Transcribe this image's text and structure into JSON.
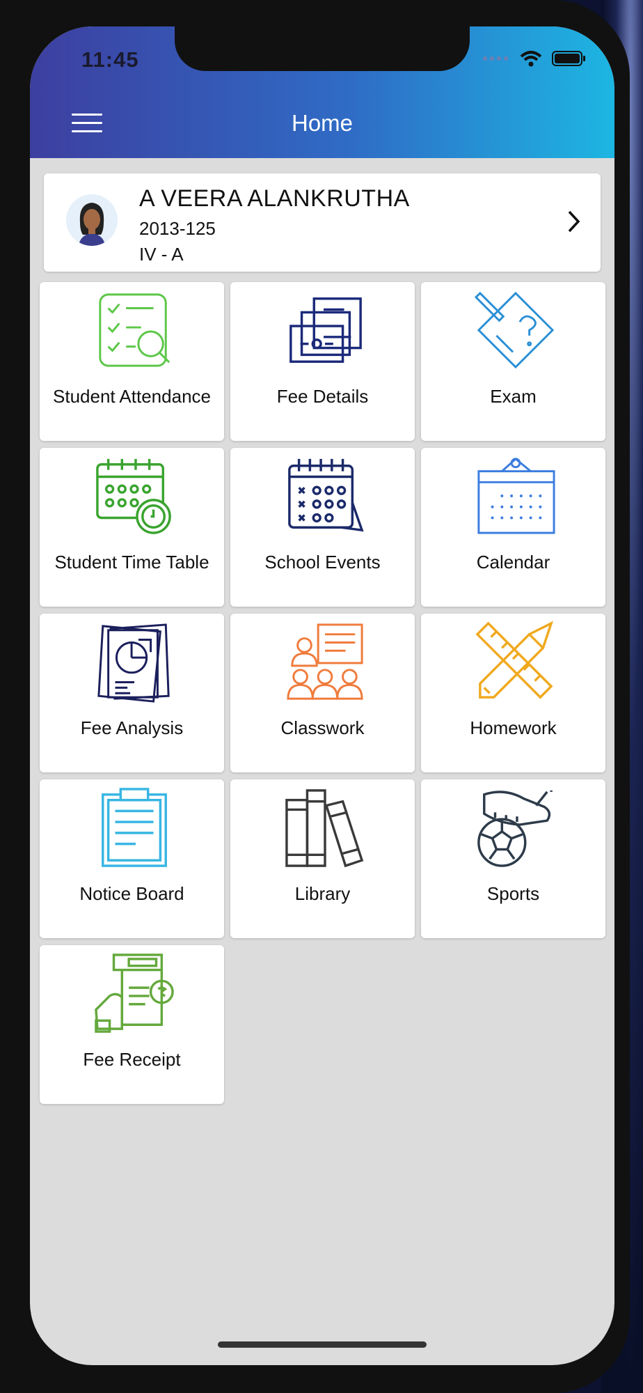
{
  "status_bar": {
    "time": "11:45"
  },
  "header": {
    "title": "Home"
  },
  "student": {
    "name": "A VEERA ALANKRUTHA",
    "id": "2013-125",
    "class": "IV - A"
  },
  "tiles": [
    {
      "label": "Student Attendance",
      "icon": "attendance-checklist-icon",
      "color": "#5cc748"
    },
    {
      "label": "Fee Details",
      "icon": "money-bills-icon",
      "color": "#1b2a7a"
    },
    {
      "label": "Exam",
      "icon": "exam-paper-icon",
      "color": "#2a8fd6"
    },
    {
      "label": "Student Time Table",
      "icon": "calendar-clock-icon",
      "color": "#3aa42f"
    },
    {
      "label": "School Events",
      "icon": "event-calendar-icon",
      "color": "#1b2a6a"
    },
    {
      "label": "Calendar",
      "icon": "wall-calendar-icon",
      "color": "#3c7de0"
    },
    {
      "label": "Fee Analysis",
      "icon": "pie-chart-report-icon",
      "color": "#1b1f5c"
    },
    {
      "label": "Classwork",
      "icon": "classroom-icon",
      "color": "#f07b3c"
    },
    {
      "label": "Homework",
      "icon": "pencil-ruler-icon",
      "color": "#f0a91e"
    },
    {
      "label": "Notice Board",
      "icon": "clipboard-icon",
      "color": "#37b6e3"
    },
    {
      "label": "Library",
      "icon": "books-icon",
      "color": "#3a3a3a"
    },
    {
      "label": "Sports",
      "icon": "football-boot-icon",
      "color": "#2d3b4a"
    },
    {
      "label": "Fee Receipt",
      "icon": "receipt-hand-icon",
      "color": "#64a93c"
    }
  ]
}
